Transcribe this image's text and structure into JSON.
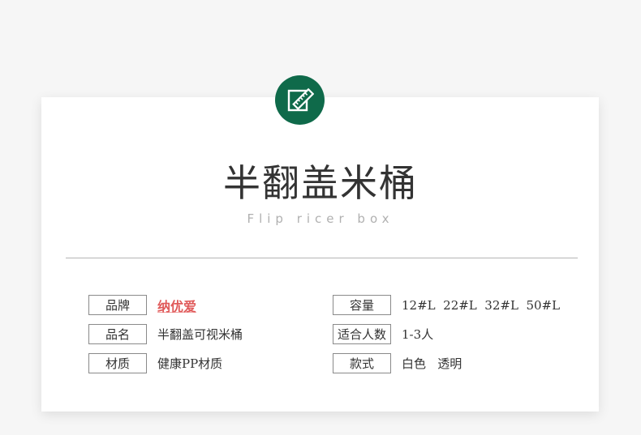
{
  "header": {
    "icon": "ruler-pencil-icon",
    "badge_color": "#0f6a4a",
    "title": "半翻盖米桶",
    "subtitle": "Flip ricer box"
  },
  "specs": {
    "left": [
      {
        "label": "品牌",
        "value": "纳优爱",
        "value_is_logo": true
      },
      {
        "label": "品名",
        "value": "半翻盖可视米桶"
      },
      {
        "label": "材质",
        "value": "健康PP材质"
      }
    ],
    "right": [
      {
        "label": "容量",
        "value": "12#L  22#L  32#L  50#L"
      },
      {
        "label": "适合人数",
        "value": "1-3人"
      },
      {
        "label": "款式",
        "value": "白色   透明"
      }
    ]
  }
}
